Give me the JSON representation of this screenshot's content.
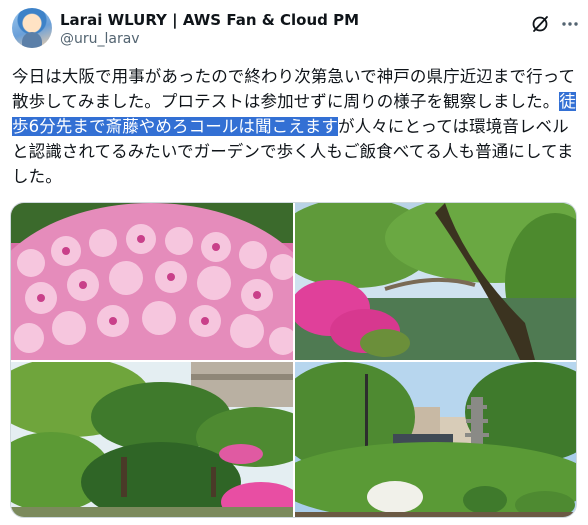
{
  "post": {
    "author": {
      "display_name": "Larai WLURY | AWS Fan & Cloud PM",
      "handle": "@uru_larav"
    },
    "text_before": "今日は大阪で用事があったので終わり次第急いで神戸の県庁近辺まで行って散歩してみました。プロテストは参加せずに周りの様子を観察しました。",
    "text_highlight": "徒歩6分先まで斎藤やめろコールは聞こえます",
    "text_after": "が人々にとっては環境音レベルと認識されてるみたいでガーデンで歩く人もご飯食べてる人も普通にしてました。",
    "highlight_color": "#3370d4",
    "icons": {
      "grok": "grok-icon",
      "more": "more-icon"
    }
  },
  "media": [
    {
      "subject": "pink-azalea-flowers"
    },
    {
      "subject": "garden-pond-with-bridge"
    },
    {
      "subject": "garden-pine-trees-and-building"
    },
    {
      "subject": "garden-pagoda-and-buildings"
    }
  ]
}
